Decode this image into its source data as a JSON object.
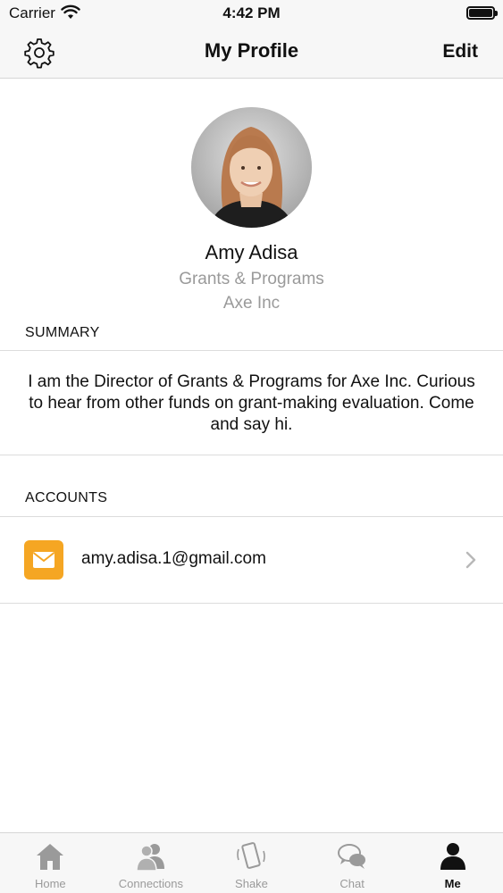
{
  "status_bar": {
    "carrier": "Carrier",
    "time": "4:42 PM"
  },
  "nav": {
    "title": "My Profile",
    "edit_label": "Edit",
    "settings_icon": "gear-icon"
  },
  "profile": {
    "name": "Amy Adisa",
    "role": "Grants & Programs",
    "company": "Axe Inc"
  },
  "summary": {
    "header": "SUMMARY",
    "text": "I am the Director of Grants & Programs for Axe Inc. Curious to hear from other funds on grant-making evaluation. Come and say hi."
  },
  "accounts": {
    "header": "ACCOUNTS",
    "items": [
      {
        "icon": "mail-icon",
        "email": "amy.adisa.1@gmail.com",
        "icon_color": "#f5a623"
      }
    ]
  },
  "tabs": [
    {
      "label": "Home",
      "icon": "home-icon",
      "active": false
    },
    {
      "label": "Connections",
      "icon": "connections-icon",
      "active": false
    },
    {
      "label": "Shake",
      "icon": "shake-icon",
      "active": false
    },
    {
      "label": "Chat",
      "icon": "chat-icon",
      "active": false
    },
    {
      "label": "Me",
      "icon": "person-icon",
      "active": true
    }
  ]
}
